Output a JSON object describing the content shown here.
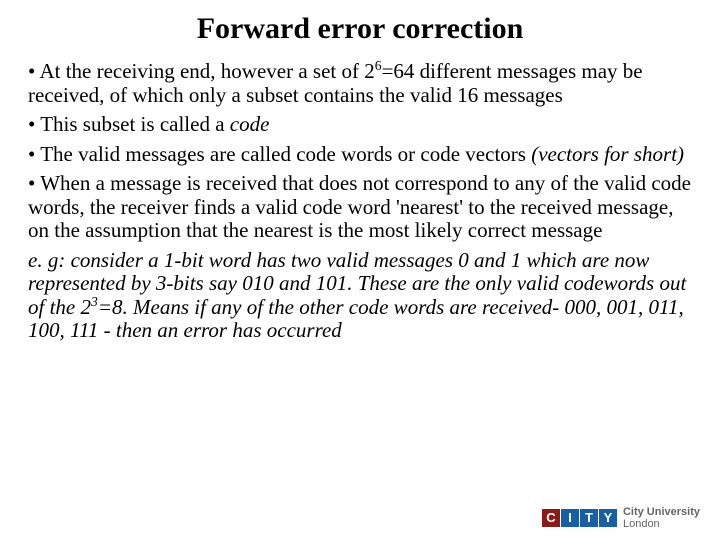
{
  "title": "Forward error correction",
  "p1a": "• At the receiving end, however a set of 2",
  "p1sup": "6",
  "p1b": "=64 different messages may be received, of which only a subset contains the valid 16 messages",
  "p2a": "• This subset is called a ",
  "p2i": "code",
  "p3a": "• The valid messages are called code words or code vectors ",
  "p3i": "(vectors for short)",
  "p4": "• When a message is received that does not correspond to any of the valid code words, the receiver finds a valid code word 'nearest' to the received message, on the assumption that the nearest is the most likely correct message",
  "p5a": "e. g: consider a 1-bit word has two valid messages 0 and 1 which are now represented by 3-bits say 010 and 101. These are the only valid codewords out of the 2",
  "p5sup": "3",
  "p5b": "=8. Means if any of the other code words are received- 000, 001, 011, 100, 111 - then an error has occurred",
  "logo": {
    "l1": "C",
    "l2": "I",
    "l3": "T",
    "l4": "Y",
    "t1": "City University",
    "t2": "London"
  }
}
